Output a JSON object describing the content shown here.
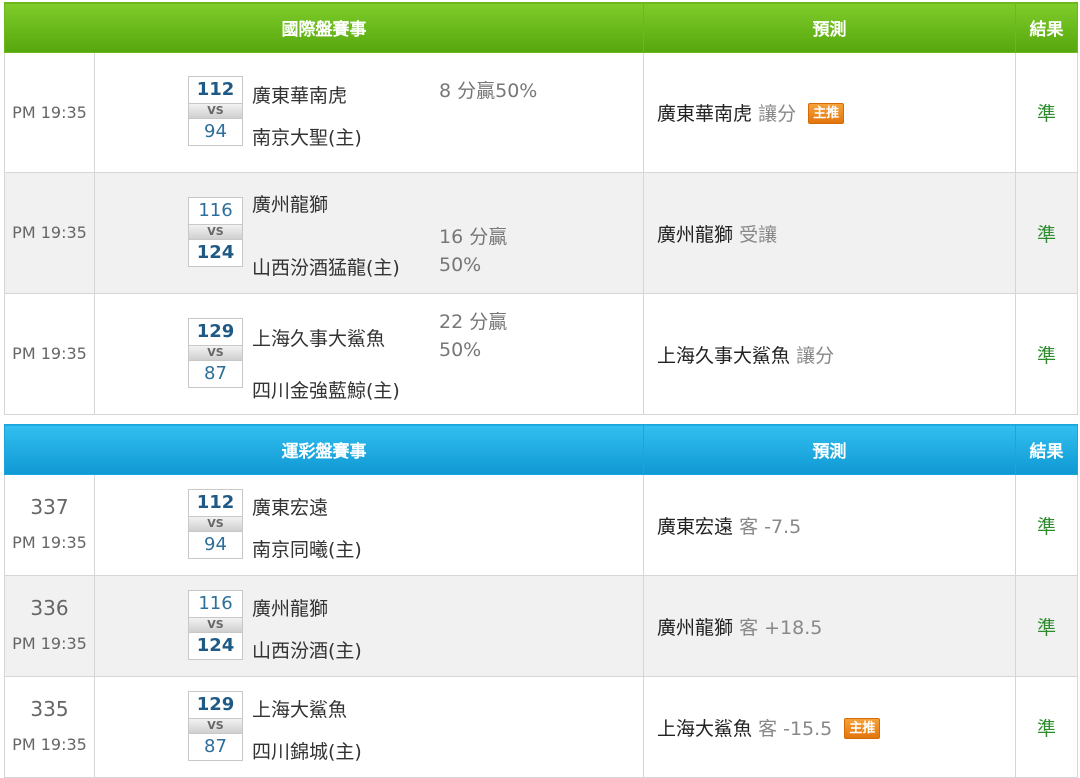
{
  "international": {
    "header": {
      "matches": "國際盤賽事",
      "prediction": "預測",
      "result": "結果"
    },
    "rows": [
      {
        "time": "PM 19:35",
        "score1": "112",
        "score2": "94",
        "vs": "VS",
        "team1": "廣東華南虎",
        "team2": "南京大聖(主)",
        "handicap_line1": "8 分贏50%",
        "handicap_line2": "",
        "pred_team": "廣東華南虎",
        "pred_type": "讓分",
        "badge": "主推",
        "result": "準"
      },
      {
        "time": "PM 19:35",
        "score1": "116",
        "score2": "124",
        "vs": "VS",
        "team1": "廣州龍獅",
        "team2": "山西汾酒猛龍(主)",
        "handicap_line1": "16 分贏",
        "handicap_line2": "50%",
        "pred_team": "廣州龍獅",
        "pred_type": "受讓",
        "badge": "",
        "result": "準"
      },
      {
        "time": "PM 19:35",
        "score1": "129",
        "score2": "87",
        "vs": "VS",
        "team1": "上海久事大鯊魚",
        "team2": "四川金強藍鯨(主)",
        "handicap_line1": "22 分贏",
        "handicap_line2": "50%",
        "pred_team": "上海久事大鯊魚",
        "pred_type": "讓分",
        "badge": "",
        "result": "準"
      }
    ]
  },
  "sports_lottery": {
    "header": {
      "matches": "運彩盤賽事",
      "prediction": "預測",
      "result": "結果"
    },
    "rows": [
      {
        "num": "337",
        "time": "PM 19:35",
        "score1": "112",
        "score2": "94",
        "vs": "VS",
        "team1": "廣東宏遠",
        "team2": "南京同曦(主)",
        "pred_team": "廣東宏遠",
        "pred_type": "客 -7.5",
        "badge": "",
        "result": "準"
      },
      {
        "num": "336",
        "time": "PM 19:35",
        "score1": "116",
        "score2": "124",
        "vs": "VS",
        "team1": "廣州龍獅",
        "team2": "山西汾酒(主)",
        "pred_team": "廣州龍獅",
        "pred_type": "客 +18.5",
        "badge": "",
        "result": "準"
      },
      {
        "num": "335",
        "time": "PM 19:35",
        "score1": "129",
        "score2": "87",
        "vs": "VS",
        "team1": "上海大鯊魚",
        "team2": "四川錦城(主)",
        "pred_team": "上海大鯊魚",
        "pred_type": "客 -15.5",
        "badge": "主推",
        "result": "準"
      }
    ]
  }
}
